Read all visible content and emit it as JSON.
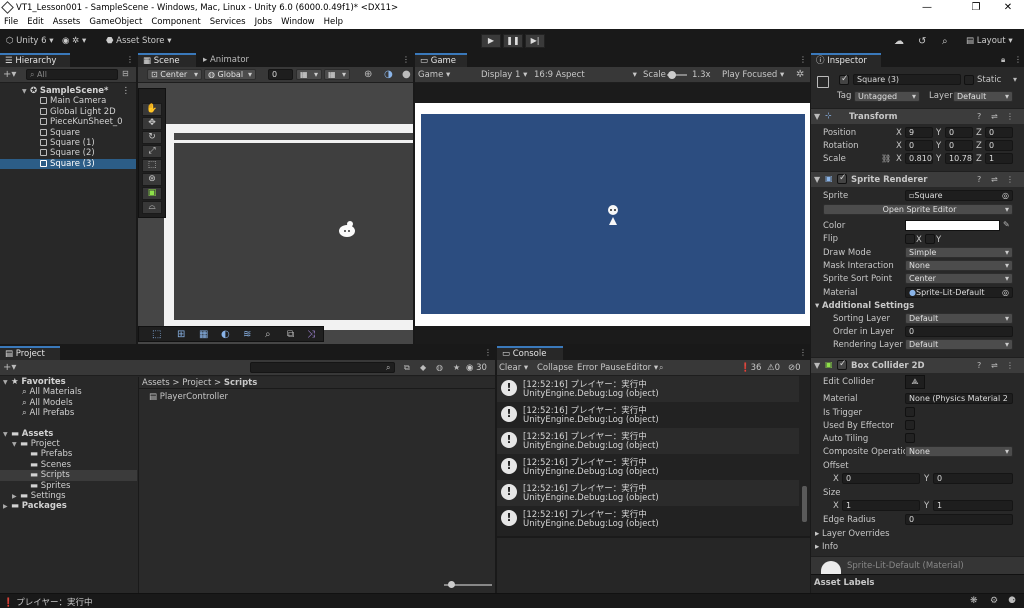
{
  "window": {
    "title": "VT1_Lesson001 - SampleScene - Windows, Mac, Linux - Unity 6.0 (6000.0.49f1)* <DX11>",
    "controls": [
      "—",
      "❐",
      "✕"
    ]
  },
  "menu": [
    "File",
    "Edit",
    "Assets",
    "GameObject",
    "Component",
    "Services",
    "Jobs",
    "Window",
    "Help"
  ],
  "toolbar": {
    "unity_label": "Unity 6",
    "asset_store": "Asset Store",
    "layout": "Layout"
  },
  "hierarchy": {
    "tab": "Hierarchy",
    "search_placeholder": "All",
    "scene": "SampleScene*",
    "items": [
      "Main Camera",
      "Global Light 2D",
      "PieceKunSheet_0",
      "Square",
      "Square (1)",
      "Square (2)",
      "Square (3)"
    ]
  },
  "scene": {
    "tabs": [
      "Scene",
      "Animator"
    ],
    "pivot": "Center",
    "space": "Global",
    "snap_value": "0"
  },
  "game": {
    "tab": "Game",
    "mode": "Game",
    "display": "Display 1",
    "aspect": "16:9 Aspect",
    "scale_label": "Scale",
    "scale_value": "1.3x",
    "play_mode": "Play Focused",
    "bg_color": "#2c4d80"
  },
  "inspector": {
    "tab": "Inspector",
    "object_name": "Square (3)",
    "static_label": "Static",
    "tag_label": "Tag",
    "tag_value": "Untagged",
    "layer_label": "Layer",
    "layer_value": "Default",
    "transform": {
      "title": "Transform",
      "position_label": "Position",
      "rotation_label": "Rotation",
      "scale_label": "Scale",
      "position": [
        "9",
        "0",
        "0"
      ],
      "rotation": [
        "0",
        "0",
        "0"
      ],
      "scale": [
        "0.8106",
        "10.784",
        "1"
      ],
      "axes": [
        "X",
        "Y",
        "Z"
      ]
    },
    "sprite_renderer": {
      "title": "Sprite Renderer",
      "sprite_label": "Sprite",
      "sprite_value": "Square",
      "open_editor": "Open Sprite Editor",
      "color_label": "Color",
      "flip_label": "Flip",
      "flip_x": "X",
      "flip_y": "Y",
      "draw_mode_label": "Draw Mode",
      "draw_mode": "Simple",
      "mask_label": "Mask Interaction",
      "mask_value": "None",
      "sort_point_label": "Sprite Sort Point",
      "sort_point": "Center",
      "material_label": "Material",
      "material_value": "Sprite-Lit-Default",
      "additional": "Additional Settings",
      "sorting_layer_label": "Sorting Layer",
      "sorting_layer": "Default",
      "order_label": "Order in Layer",
      "order_value": "0",
      "rendering_layer_label": "Rendering Layer M",
      "rendering_layer": "Default"
    },
    "box_collider": {
      "title": "Box Collider 2D",
      "edit_label": "Edit Collider",
      "material_label": "Material",
      "material_value": "None (Physics Material 2",
      "trigger_label": "Is Trigger",
      "effector_label": "Used By Effector",
      "tiling_label": "Auto Tiling",
      "composite_label": "Composite Operation",
      "composite_value": "None",
      "offset_label": "Offset",
      "offset": [
        "0",
        "0"
      ],
      "size_label": "Size",
      "size": [
        "1",
        "1"
      ],
      "edge_label": "Edge Radius",
      "edge_value": "0",
      "layer_overrides": "Layer Overrides",
      "info": "Info"
    },
    "material_footer": "Sprite-Lit-Default (Material)",
    "asset_labels": "Asset Labels"
  },
  "project": {
    "tab": "Project",
    "count": "30",
    "breadcrumb": [
      "Assets",
      "Project",
      "Scripts"
    ],
    "favorites": "Favorites",
    "fav_items": [
      "All Materials",
      "All Models",
      "All Prefabs"
    ],
    "assets": "Assets",
    "tree": [
      {
        "label": "Project",
        "level": 1
      },
      {
        "label": "Prefabs",
        "level": 2
      },
      {
        "label": "Scenes",
        "level": 2
      },
      {
        "label": "Scripts",
        "level": 2
      },
      {
        "label": "Sprites",
        "level": 2
      },
      {
        "label": "Settings",
        "level": 1
      }
    ],
    "packages": "Packages",
    "files": [
      "PlayerController"
    ]
  },
  "console": {
    "tab": "Console",
    "clear": "Clear",
    "collapse": "Collapse",
    "error_pause": "Error Pause",
    "editor": "Editor",
    "counts": [
      "36",
      "0",
      "0"
    ],
    "logs": [
      {
        "line1": "[12:52:16] プレイヤー：実行中",
        "line2": "UnityEngine.Debug:Log (object)"
      },
      {
        "line1": "[12:52:16] プレイヤー：実行中",
        "line2": "UnityEngine.Debug:Log (object)"
      },
      {
        "line1": "[12:52:16] プレイヤー：実行中",
        "line2": "UnityEngine.Debug:Log (object)"
      },
      {
        "line1": "[12:52:16] プレイヤー：実行中",
        "line2": "UnityEngine.Debug:Log (object)"
      },
      {
        "line1": "[12:52:16] プレイヤー：実行中",
        "line2": "UnityEngine.Debug:Log (object)"
      },
      {
        "line1": "[12:52:16] プレイヤー：実行中",
        "line2": "UnityEngine.Debug:Log (object)"
      }
    ]
  },
  "status": {
    "message": "プレイヤー：実行中"
  }
}
